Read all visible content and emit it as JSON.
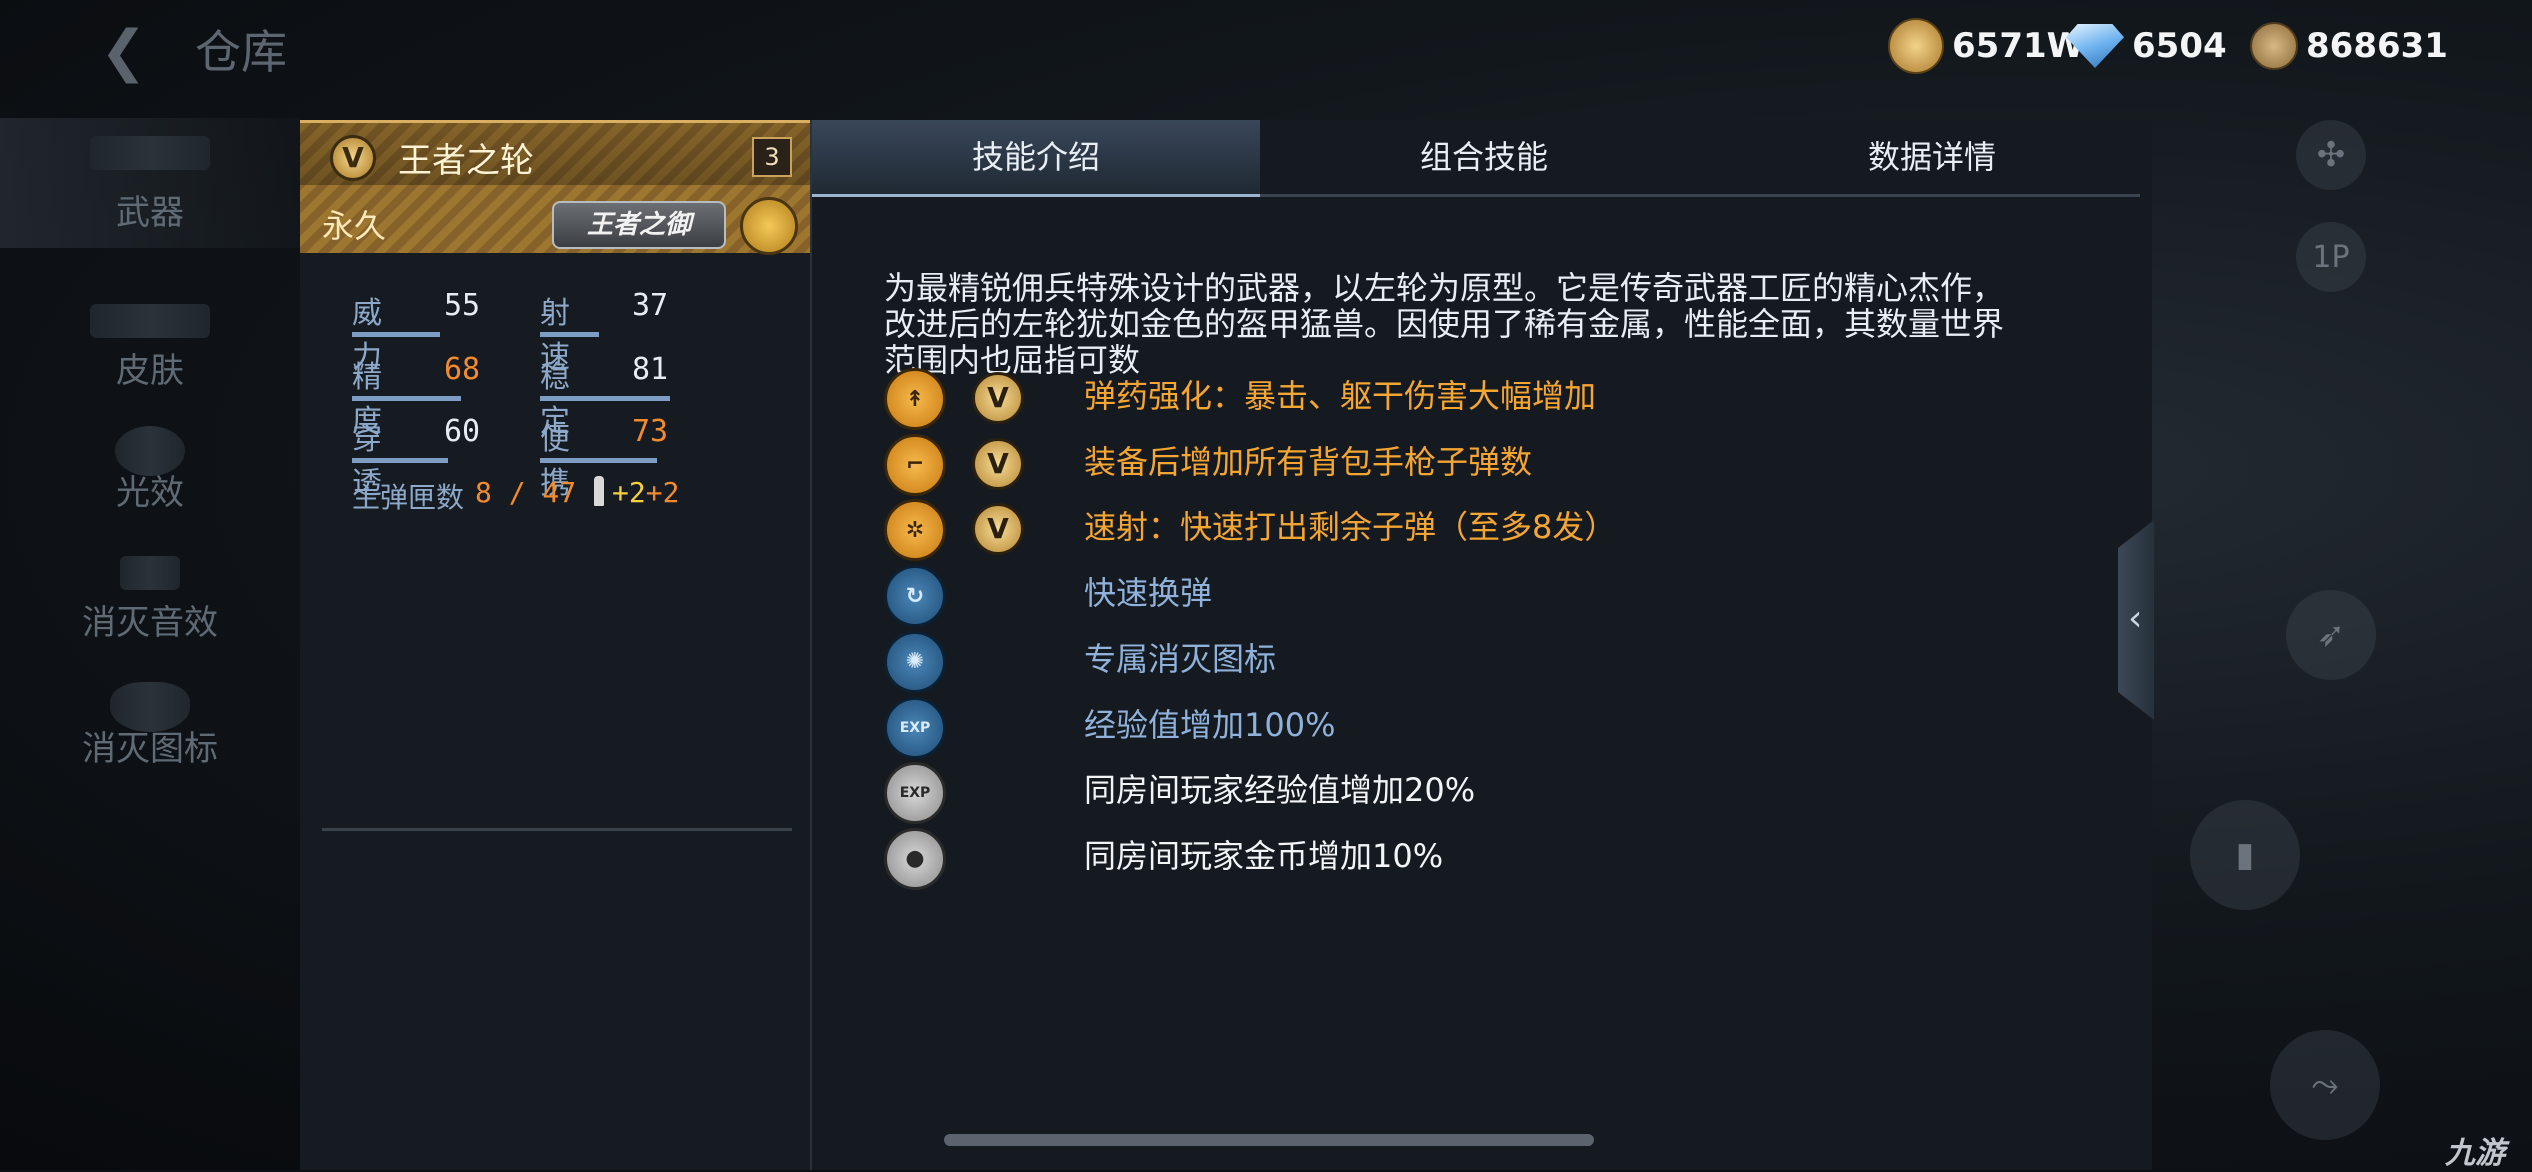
{
  "header": {
    "back_icon": "chevron-left-icon",
    "title": "仓库",
    "currencies": [
      {
        "icon": "gold-bar-icon",
        "value": "6571W"
      },
      {
        "icon": "diamond-icon",
        "value": "6504"
      },
      {
        "icon": "medal-coin-icon",
        "value": "868631"
      }
    ]
  },
  "sidebar": {
    "items": [
      {
        "label": "武器",
        "active": true
      },
      {
        "label": "皮肤"
      },
      {
        "label": "光效"
      },
      {
        "label": "消灭音效"
      },
      {
        "label": "消灭图标"
      }
    ]
  },
  "weapon": {
    "badge": "V",
    "name": "王者之轮",
    "level": "3",
    "duration": "永久",
    "title_badge": "王者之御",
    "stats": [
      {
        "label": "威力",
        "value": "55",
        "bar": 0.55,
        "highlight": false
      },
      {
        "label": "射速",
        "value": "37",
        "bar": 0.37,
        "highlight": false
      },
      {
        "label": "精度",
        "value": "68",
        "bar": 0.68,
        "highlight": true
      },
      {
        "label": "稳定",
        "value": "81",
        "bar": 0.81,
        "highlight": false
      },
      {
        "label": "穿透",
        "value": "60",
        "bar": 0.6,
        "highlight": false
      },
      {
        "label": "便携",
        "value": "73",
        "bar": 0.73,
        "highlight": true
      }
    ],
    "ammo_label": "主弹匣数",
    "ammo_value": "8 / 47",
    "bonus_a": "+2",
    "bonus_b": "+2"
  },
  "tabs": [
    "技能介绍",
    "组合技能",
    "数据详情"
  ],
  "active_tab": 0,
  "description": "为最精锐佣兵特殊设计的武器，以左轮为原型。它是传奇武器工匠的精心杰作，改进后的左轮犹如金色的盔甲猛兽。因使用了稀有金属，性能全面，其数量世界范围内也屈指可数",
  "skills": [
    {
      "icon": "ammo-boost-icon",
      "style": "gold",
      "v": true,
      "text": "弹药强化：暴击、躯干伤害大幅增加",
      "color": "orange"
    },
    {
      "icon": "pistol-icon",
      "style": "gold",
      "v": true,
      "text": "装备后增加所有背包手枪子弹数",
      "color": "orange"
    },
    {
      "icon": "revolver-cylinder-icon",
      "style": "gold",
      "v": true,
      "text": "速射：快速打出剩余子弹（至多8发）",
      "color": "orange"
    },
    {
      "icon": "fast-reload-icon",
      "style": "blue",
      "v": false,
      "text": "快速换弹",
      "color": "blue"
    },
    {
      "icon": "kill-icon",
      "style": "blue",
      "v": false,
      "text": "专属消灭图标",
      "color": "blue"
    },
    {
      "icon": "exp-icon",
      "style": "blue",
      "v": false,
      "text": "经验值增加100%",
      "color": "blue"
    },
    {
      "icon": "room-exp-icon",
      "style": "gray",
      "v": false,
      "text": "同房间玩家经验值增加20%",
      "color": "white"
    },
    {
      "icon": "room-coin-icon",
      "style": "gray",
      "v": false,
      "text": "同房间玩家金币增加10%",
      "color": "white"
    }
  ],
  "right_controls": {
    "gamepad_icon": "gamepad-icon",
    "view_label": "1P"
  },
  "watermark": "九游"
}
